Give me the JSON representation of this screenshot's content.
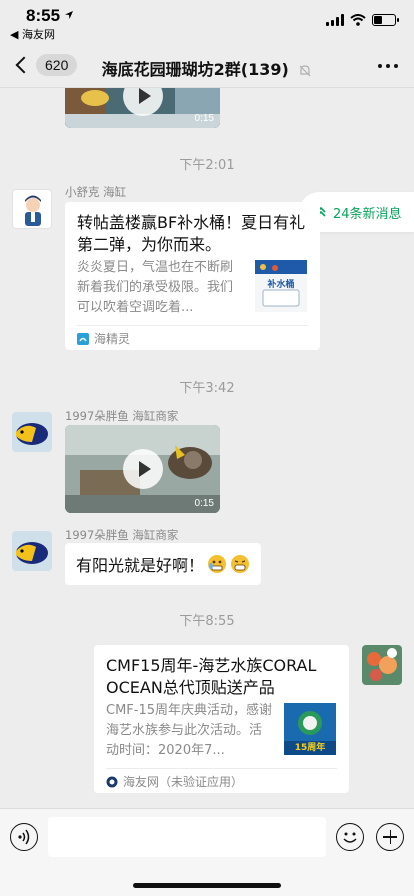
{
  "status_bar": {
    "time": "8:55",
    "back_app": "◀ 海友网"
  },
  "nav": {
    "unread_count": "620",
    "title": "海底花园珊瑚坊2群(139)"
  },
  "new_messages": {
    "label": "24条新消息"
  },
  "messages": [
    {
      "type": "video",
      "duration": "0:15"
    },
    {
      "type": "time",
      "text": "下午2:01"
    },
    {
      "type": "card",
      "sender": "小舒克 海缸",
      "title": "转帖盖楼赢BF补水桶！夏日有礼第二弹，为你而来。",
      "desc": "炎炎夏日，气温也在不断刷新着我们的承受极限。我们可以吹着空调吃着...",
      "thumb_text": "补水桶",
      "source": "海精灵"
    },
    {
      "type": "time",
      "text": "下午3:42"
    },
    {
      "type": "video",
      "sender": "1997朵胖鱼 海缸商家",
      "duration": "0:15"
    },
    {
      "type": "text",
      "sender": "1997朵胖鱼 海缸商家",
      "text": "有阳光就是好啊！"
    },
    {
      "type": "time",
      "text": "下午8:55"
    },
    {
      "type": "card",
      "title": "CMF15周年-海艺水族CORAL OCEAN总代顶贴送产品",
      "desc": "CMF-15周年庆典活动，感谢海艺水族参与此次活动。活动时间：2020年7...",
      "thumb_text": "15周年",
      "source": "海友网（未验证应用）"
    }
  ],
  "colors": {
    "accent_green": "#07a35a",
    "chat_bg": "#ededed"
  }
}
